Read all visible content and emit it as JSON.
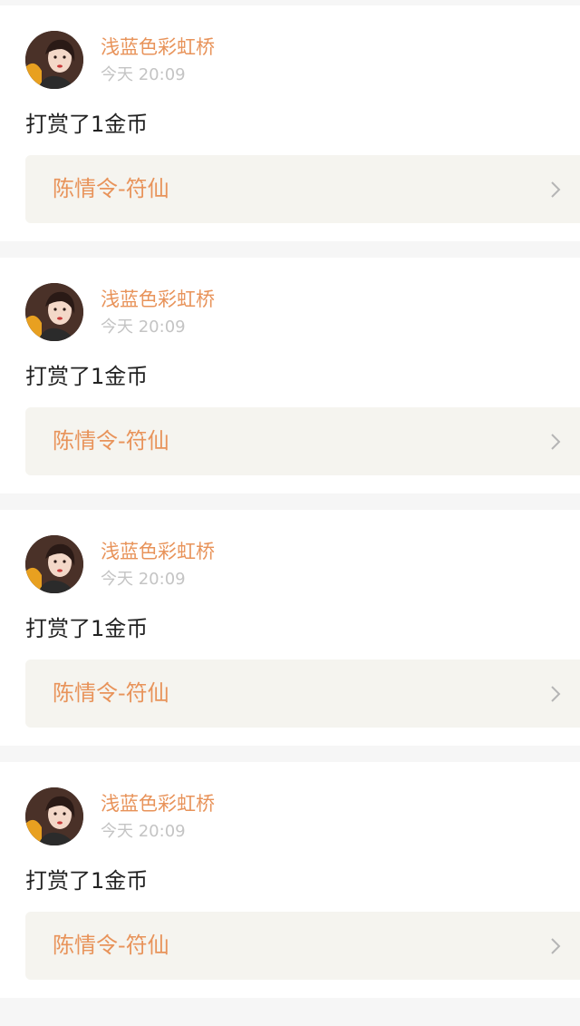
{
  "feed": {
    "items": [
      {
        "username": "浅蓝色彩虹桥",
        "time": "今天 20:09",
        "content": "打赏了1金币",
        "link_title": "陈情令-符仙"
      },
      {
        "username": "浅蓝色彩虹桥",
        "time": "今天 20:09",
        "content": "打赏了1金币",
        "link_title": "陈情令-符仙"
      },
      {
        "username": "浅蓝色彩虹桥",
        "time": "今天 20:09",
        "content": "打赏了1金币",
        "link_title": "陈情令-符仙"
      },
      {
        "username": "浅蓝色彩虹桥",
        "time": "今天 20:09",
        "content": "打赏了1金币",
        "link_title": "陈情令-符仙"
      }
    ]
  },
  "icons": {
    "avatar": "user-avatar",
    "chevron": "chevron-right-icon"
  },
  "colors": {
    "accent": "#e8935a",
    "text": "#222222",
    "muted": "#c4c4c4",
    "link_bg": "#f5f4ef",
    "page_bg": "#f6f6f6"
  }
}
